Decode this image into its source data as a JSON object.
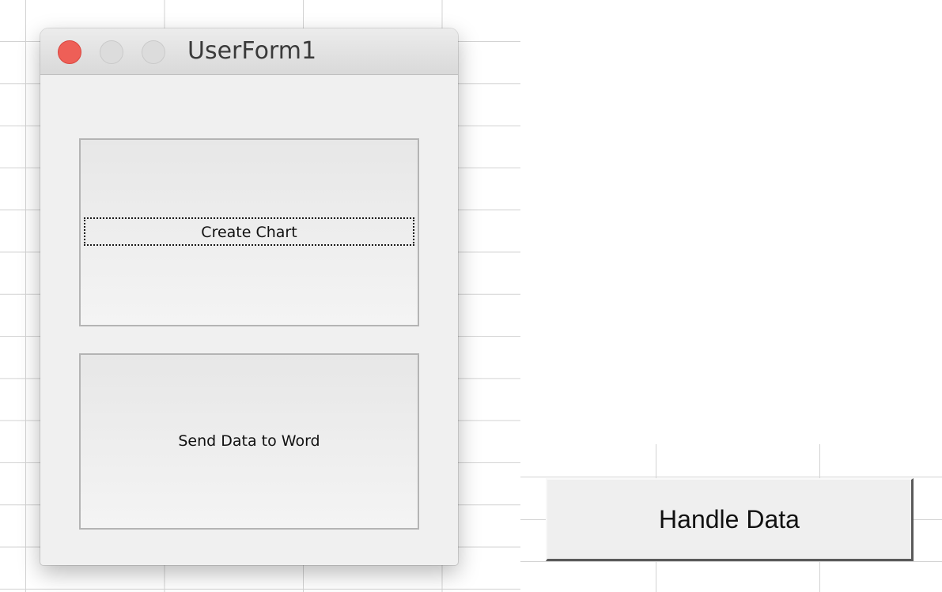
{
  "window": {
    "title": "UserForm1"
  },
  "form": {
    "create_chart_label": "Create Chart",
    "send_to_word_label": "Send Data to Word"
  },
  "sheet": {
    "handle_data_label": "Handle Data"
  },
  "colors": {
    "close_button": "#ee5f57",
    "window_bg": "#f0f0f0",
    "gridline": "#d3d3d3"
  },
  "icons": {
    "close": "close-icon",
    "minimize": "minimize-icon",
    "zoom": "zoom-icon"
  }
}
